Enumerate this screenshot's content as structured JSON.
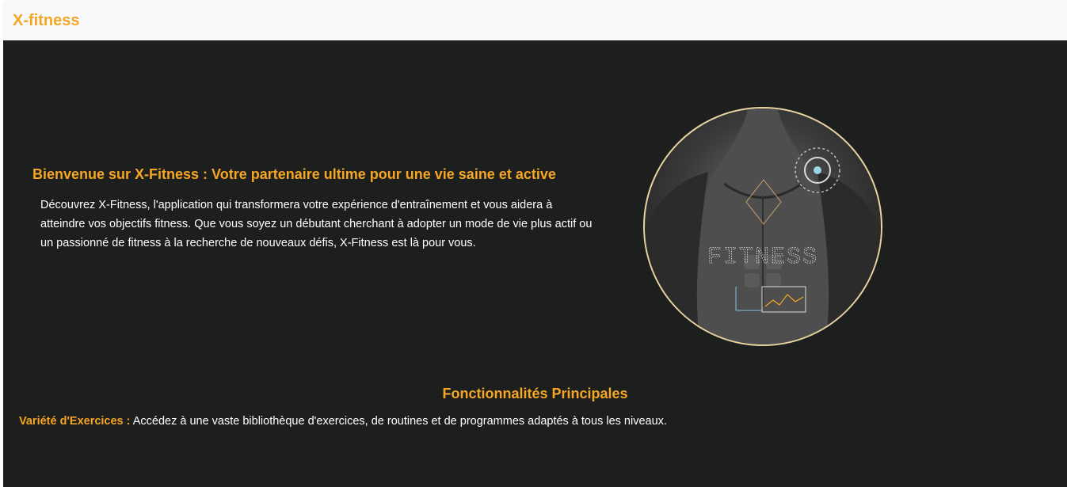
{
  "navbar": {
    "brand": "X-fitness"
  },
  "hero": {
    "title": "Bienvenue sur X-Fitness : Votre partenaire ultime pour une vie saine et active",
    "description": "Découvrez X-Fitness, l'application qui transformera votre expérience d'entraînement et vous aidera à atteindre vos objectifs fitness. Que vous soyez un débutant cherchant à adopter un mode de vie plus actif ou un passionné de fitness à la recherche de nouveaux défis, X-Fitness est là pour vous.",
    "image_caption": "FITNESS"
  },
  "features": {
    "title": "Fonctionnalités Principales",
    "items": [
      {
        "name": "Variété d'Exercices :",
        "text": " Accédez à une vaste bibliothèque d'exercices, de routines et de programmes adaptés à tous les niveaux."
      }
    ]
  },
  "colors": {
    "accent": "#f5a623",
    "background": "#1d1e1e",
    "navbar": "#f8f9fa"
  }
}
